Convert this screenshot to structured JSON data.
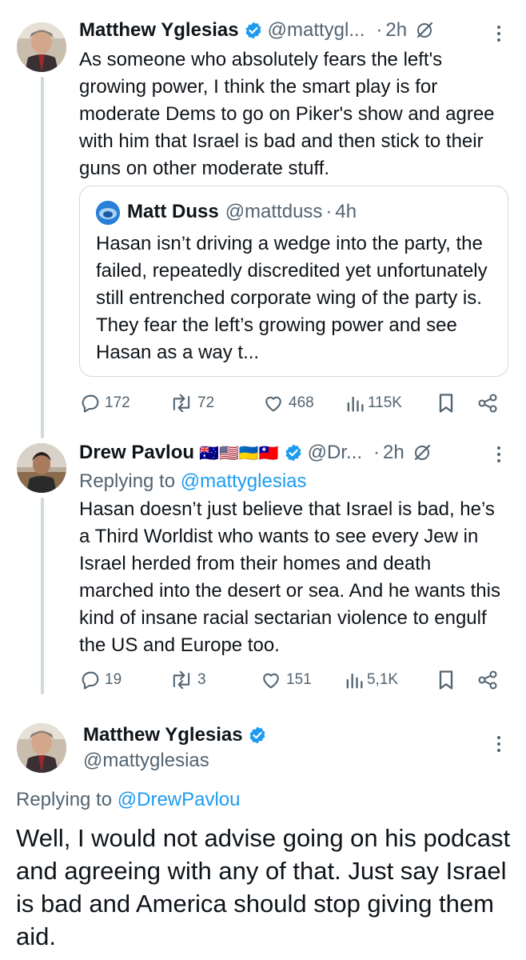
{
  "tweets": [
    {
      "name": "Matthew Yglesias",
      "handle": "@mattygl...",
      "time": "2h",
      "text": "As someone who absolutely fears the left's growing power, I think the smart play is for moderate Dems to go on Piker's show and agree with him that Israel is bad and then stick to their guns on other moderate stuff.",
      "quote": {
        "name": "Matt Duss",
        "handle": "@mattduss",
        "time": "4h",
        "text": "Hasan isn’t driving a wedge into the party, the failed, repeatedly discredited yet unfortunately still entrenched corporate wing of the party is. They fear the left’s growing power and see Hasan as a way t..."
      },
      "stats": {
        "replies": "172",
        "reposts": "72",
        "likes": "468",
        "views": "115K"
      }
    },
    {
      "name": "Drew Pavlou",
      "flags": "🇦🇺🇺🇸🇺🇦🇹🇼",
      "handle": "@Dr...",
      "time": "2h",
      "replying_label": "Replying to",
      "replying_to": "@mattyglesias",
      "text": "Hasan doesn’t just believe that Israel is bad, he’s a Third Worldist who wants to see every Jew in Israel herded from their homes and death marched into the desert or sea. And he wants this kind of insane racial sectarian violence to engulf the US and Europe too.",
      "stats": {
        "replies": "19",
        "reposts": "3",
        "likes": "151",
        "views": "5,1K"
      }
    },
    {
      "name": "Matthew Yglesias",
      "handle": "@mattyglesias",
      "replying_label": "Replying to",
      "replying_to": "@DrewPavlou",
      "text": "Well, I would not advise going on his podcast and agreeing with any of that. Just say Israel is bad and America should stop giving them aid."
    }
  ],
  "separator": "·",
  "icons": [
    "verified-icon",
    "grok-icon",
    "more-icon",
    "reply-icon",
    "repost-icon",
    "like-icon",
    "views-icon",
    "bookmark-icon",
    "share-icon"
  ],
  "colors": {
    "accent": "#1d9bf0",
    "secondary_text": "#536471",
    "border": "#cfd9de"
  }
}
